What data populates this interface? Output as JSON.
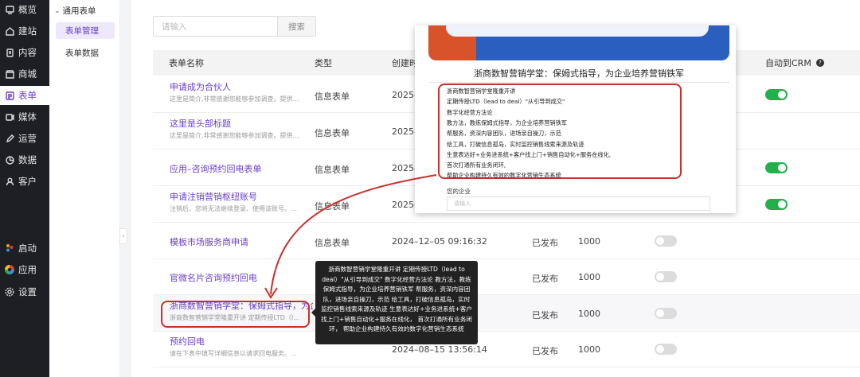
{
  "nav": {
    "items": [
      {
        "label": "概览",
        "icon": "dashboard-icon"
      },
      {
        "label": "建站",
        "icon": "home-icon"
      },
      {
        "label": "内容",
        "icon": "document-icon"
      },
      {
        "label": "商城",
        "icon": "store-icon"
      },
      {
        "label": "表单",
        "icon": "form-icon"
      },
      {
        "label": "媒体",
        "icon": "media-icon"
      },
      {
        "label": "运营",
        "icon": "edit-icon"
      },
      {
        "label": "数据",
        "icon": "data-icon"
      },
      {
        "label": "客户",
        "icon": "user-icon"
      }
    ],
    "bottom": [
      {
        "label": "启动",
        "icon": "launch-icon"
      },
      {
        "label": "应用",
        "icon": "apps-icon"
      },
      {
        "label": "设置",
        "icon": "gear-icon"
      }
    ]
  },
  "subnav": {
    "group": "通用表单",
    "items": [
      "表单管理",
      "表单数据"
    ]
  },
  "search": {
    "placeholder": "请输入",
    "button": "搜索"
  },
  "table": {
    "headers": {
      "name": "表单名称",
      "type": "类型",
      "date": "创建时",
      "crm": "自动到CRM"
    },
    "rows": [
      {
        "title": "申请成为合伙人",
        "desc": "这里是简介,非常感谢您能够参加调查。提供…",
        "type": "信息表单",
        "date": "2025–",
        "status": "",
        "count": "",
        "crm": true
      },
      {
        "title": "这里是头部标题",
        "desc": "这里是简介,非常感谢您能够参加调查。提供…",
        "type": "信息表单",
        "date": "2025–",
        "status": "",
        "count": "",
        "crm": false
      },
      {
        "title": "应用–咨询预约回电表单",
        "desc": "",
        "type": "信息表单",
        "date": "2025–",
        "status": "",
        "count": "",
        "crm": true
      },
      {
        "title": "申请注销营销枢纽账号",
        "desc": "注销后，您将无法继续登录、使用该账号。…",
        "type": "信息表单",
        "date": "2025–",
        "status": "",
        "count": "",
        "crm": true
      },
      {
        "title": "模板市场服务商申请",
        "desc": "",
        "type": "信息表单",
        "date": "2024–12–05 09:16:32",
        "status": "已发布",
        "count": "1000",
        "crm": false
      },
      {
        "title": "官微名片咨询预约回电",
        "desc": "",
        "type": "",
        "date": "",
        "status": "已发布",
        "count": "1000",
        "crm": false
      },
      {
        "title": "浙商数智营销学堂：保姆式指导，为企业培",
        "desc": "浙商数智营销学堂隆重开讲 定期传授LTD（l…",
        "type": "",
        "date": "",
        "status": "已发布",
        "count": "1000",
        "crm": false
      },
      {
        "title": "预约回电",
        "desc": "请在下表中填写详细信息以请求回电服务。…",
        "type": "",
        "date": "2024–08–15 13:56:14",
        "status": "已发布",
        "count": "1000",
        "crm": false
      }
    ]
  },
  "overlay": {
    "title": "浙商数智营销学堂：保姆式指导，为企业培养营销铁军",
    "lines": [
      "浙商数智营销学堂隆重开讲",
      "定期传授LTD（lead to deal）\"从引导到成交\"",
      "数字化经营方法论",
      "教方法，教练保姆式指导，为企业培养营销铁军",
      "帮服务，资深内容团队，进场亲自操刀，示范",
      "给工具，打破信息孤岛，实时监控销售线索来源及轨迹",
      "生意表达好+业务进系统+客户找上门+销售自动化+服务在线化,",
      "首次打通所有业务闭环,",
      "帮助企业构建持久有效的数字化营销生态系统"
    ],
    "field_label": "您的企业",
    "field_placeholder": "请输入"
  },
  "tooltip": {
    "text": "浙商数智营销学堂隆重开讲 定期传授LTD（lead to deal）\"从引导到成交\" 数字化经营方法论 教方法，教练保姆式指导，为企业培养营销铁军 帮服务，资深内容团队，进场亲自操刀，示范 给工具，打破信息孤岛，实时监控销售线索来源及轨迹 生意表达好+业务进系统+客户找上门+销售自动化+服务在线化， 首次打通所有业务闭环， 帮助企业构建持久有效的数字化营销生态系统"
  },
  "colors": {
    "accent": "#6a3fc7",
    "toggle_on": "#22b04b",
    "annotation": "#c8312b",
    "nav_bg": "#1d1f24"
  }
}
